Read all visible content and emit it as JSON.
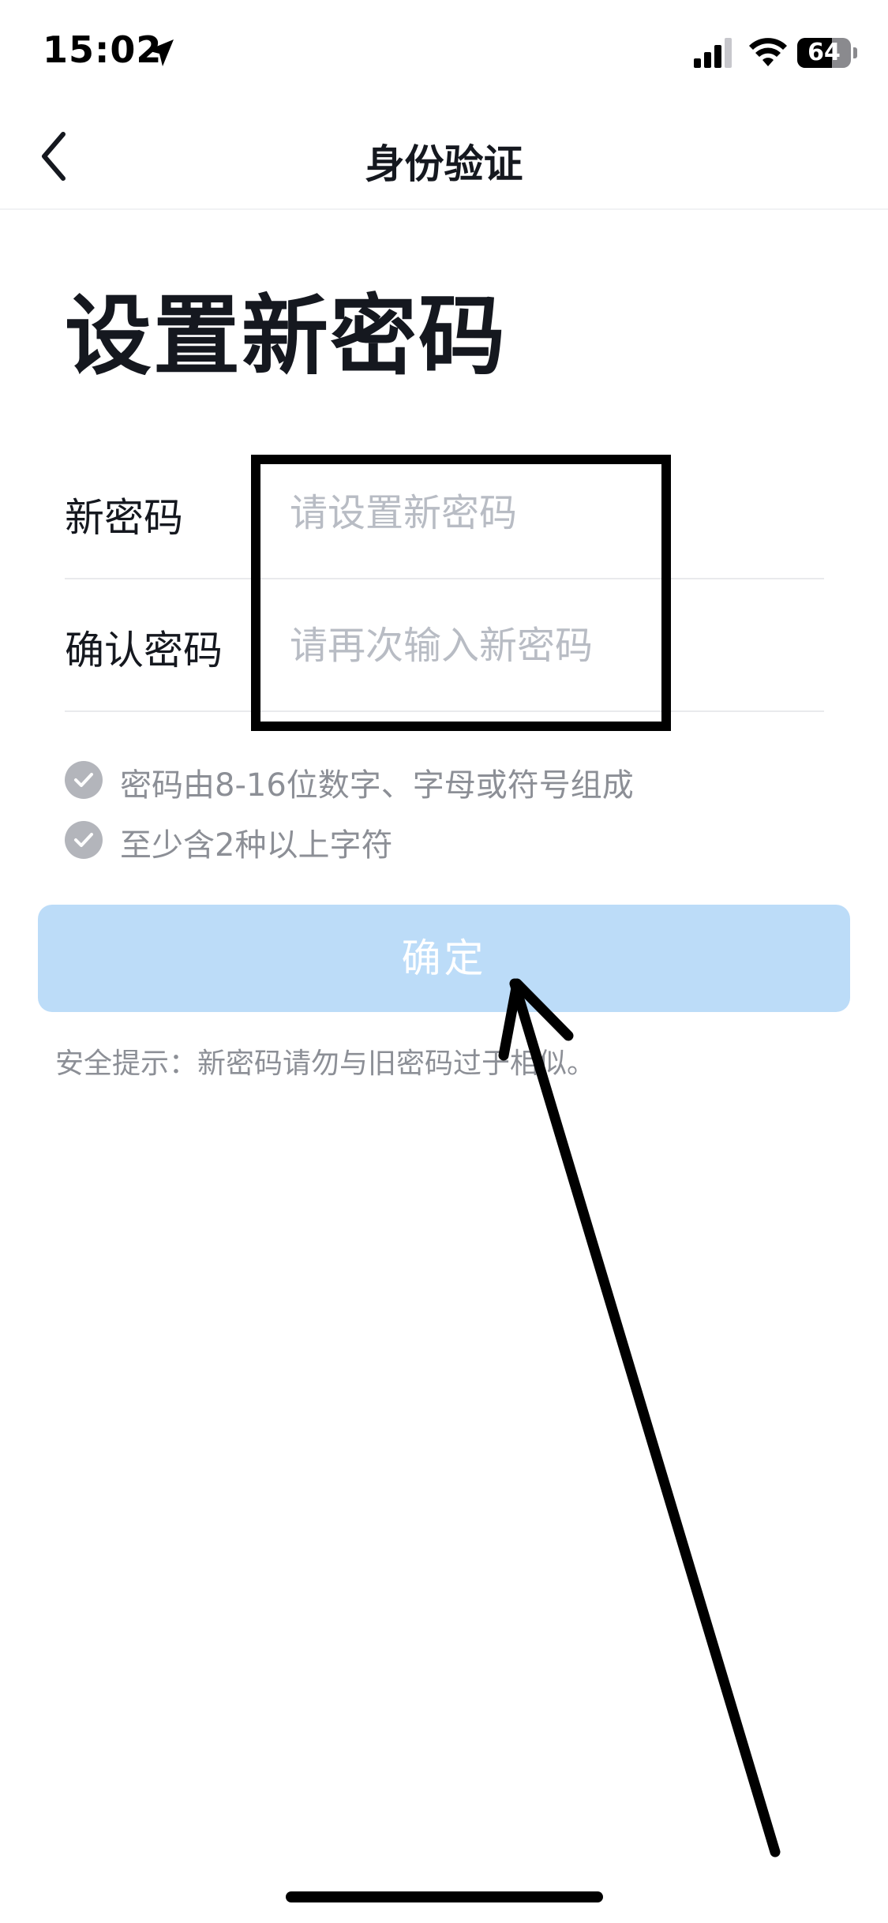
{
  "status_bar": {
    "time": "15:02",
    "battery_percent": "64",
    "battery_level": 0.64,
    "icons": [
      "location-arrow-icon",
      "cellular-signal-icon",
      "wifi-icon",
      "battery-icon"
    ]
  },
  "nav": {
    "back_icon": "chevron-left-icon",
    "title": "身份验证"
  },
  "page": {
    "title": "设置新密码"
  },
  "form": {
    "new_password": {
      "label": "新密码",
      "placeholder": "请设置新密码",
      "value": ""
    },
    "confirm_password": {
      "label": "确认密码",
      "placeholder": "请再次输入新密码",
      "value": ""
    }
  },
  "rules": [
    {
      "icon": "check-circle-icon",
      "text": "密码由8-16位数字、字母或符号组成"
    },
    {
      "icon": "check-circle-icon",
      "text": "至少含2种以上字符"
    }
  ],
  "confirm_button": {
    "label": "确定"
  },
  "security_tip": "安全提示：新密码请勿与旧密码过于相似。",
  "colors": {
    "button_disabled_bg": "#bcdcf8",
    "text_primary": "#15181f",
    "text_secondary": "#8c8f96",
    "placeholder": "#b8bcc4",
    "check_icon_bg": "#b3b5bb",
    "annotation": "#000000"
  }
}
